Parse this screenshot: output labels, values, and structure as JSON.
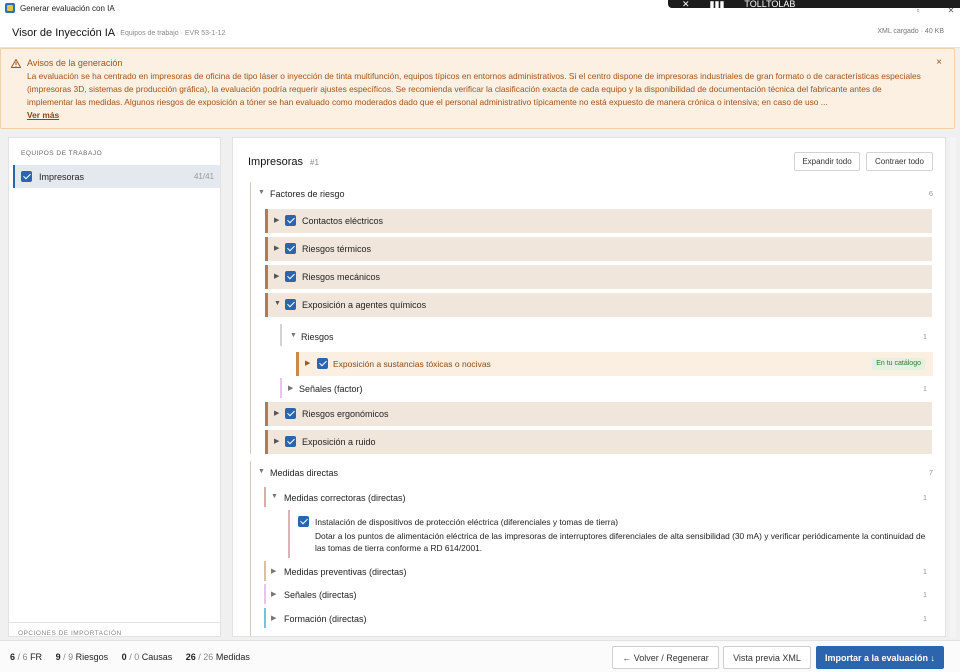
{
  "window": {
    "title": "Generar evaluación con IA",
    "overlay_items": [
      "✕",
      "▮▮▮",
      "TOLLTOLAB"
    ]
  },
  "header": {
    "title": "Visor de Inyección IA",
    "subtitle": "· Equipos de trabajo · EVR 53-1-12",
    "xml_status": "XML cargado · 40 KB"
  },
  "banner": {
    "title": "Avisos de la generación",
    "text": "La evaluación se ha centrado en impresoras de oficina de tipo láser o inyección de tinta multifunción, equipos típicos en entornos administrativos. Si el centro dispone de impresoras industriales de gran formato o de características especiales (impresoras 3D, sistemas de producción gráfica), la evaluación podría requerir ajustes específicos. Se recomienda verificar la clasificación exacta de cada equipo y la disponibilidad de documentación técnica del fabricante antes de implementar las medidas. Algunos riesgos de exposición a tóner se han evaluado como moderados dado que el personal administrativo típicamente no está expuesto de manera crónica o intensiva; en caso de uso ...",
    "more": "Ver más",
    "close": "×"
  },
  "sidebar": {
    "heading": "EQUIPOS DE TRABAJO",
    "items": [
      {
        "label": "Impresoras",
        "count": "41/41"
      }
    ],
    "footer": "OPCIONES DE IMPORTACIÓN"
  },
  "main": {
    "title": "Impresoras",
    "number": "#1",
    "expand_all": "Expandir todo",
    "collapse_all": "Contraer todo",
    "risk_factors": {
      "label": "Factores de riesgo",
      "count": "6",
      "items": [
        "Contactos eléctricos",
        "Riesgos térmicos",
        "Riesgos mecánicos",
        "Exposición a agentes químicos",
        "Riesgos ergonómicos",
        "Exposición a ruido"
      ],
      "risks_group": {
        "label": "Riesgos",
        "count": "1"
      },
      "risk_item": {
        "label": "Exposición a sustancias tóxicas o nocivas",
        "tag": "En tu catálogo"
      },
      "signals": {
        "label": "Señales (factor)",
        "count": "1"
      }
    },
    "direct_measures": {
      "label": "Medidas directas",
      "count": "7",
      "corrective": {
        "label": "Medidas correctoras (directas)",
        "count": "1"
      },
      "measure": {
        "title": "Instalación de dispositivos de protección eléctrica (diferenciales y tomas de tierra)",
        "description": "Dotar a los puntos de alimentación eléctrica de las impresoras de interruptores diferenciales de alta sensibilidad (30 mA) y verificar periódicamente la continuidad de las tomas de tierra conforme a RD 614/2001."
      },
      "preventive": {
        "label": "Medidas preventivas (directas)",
        "count": "1"
      },
      "signals": {
        "label": "Señales (directas)",
        "count": "1"
      },
      "training": {
        "label": "Formación (directas)",
        "count": "1"
      }
    }
  },
  "footer": {
    "stats": [
      {
        "value": "6",
        "total": "/ 6",
        "label": "FR"
      },
      {
        "value": "9",
        "total": "/ 9",
        "label": "Riesgos"
      },
      {
        "value": "0",
        "total": "/ 0",
        "label": "Causas"
      },
      {
        "value": "26",
        "total": "/ 26",
        "label": "Medidas"
      }
    ],
    "back_button": "← Volver / Regenerar",
    "xml_button": "Vista previa XML",
    "import_button": "Importar a la evaluación ↓"
  }
}
